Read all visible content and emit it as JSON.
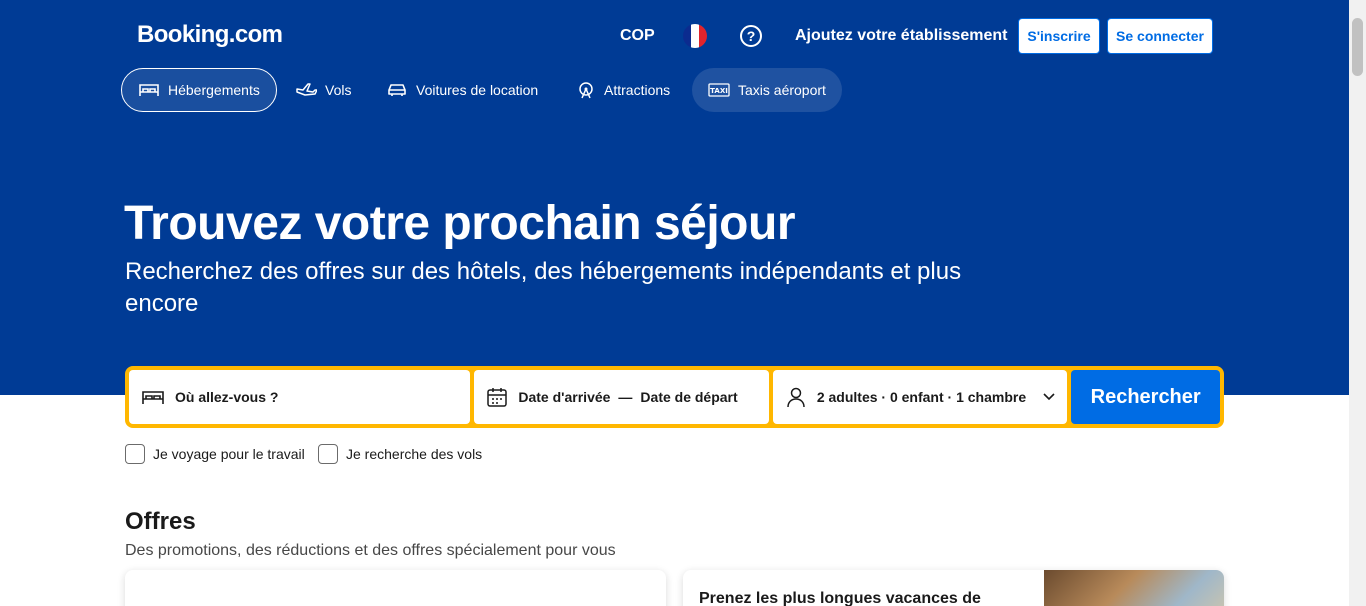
{
  "header": {
    "logo": "Booking.com",
    "currency": "COP",
    "language_flag": "france-flag",
    "help_icon": "question-icon",
    "add_property": "Ajoutez votre établissement",
    "signup": "S'inscrire",
    "signin": "Se connecter"
  },
  "nav": {
    "tabs": [
      {
        "label": "Hébergements",
        "icon": "bed-icon",
        "active": true
      },
      {
        "label": "Vols",
        "icon": "plane-icon",
        "active": false
      },
      {
        "label": "Voitures de location",
        "icon": "car-icon",
        "active": false
      },
      {
        "label": "Attractions",
        "icon": "attractions-icon",
        "active": false
      },
      {
        "label": "Taxis aéroport",
        "icon": "taxi-icon",
        "active": false
      }
    ]
  },
  "hero": {
    "title": "Trouvez votre prochain séjour",
    "subtitle": "Recherchez des offres sur des hôtels, des hébergements indépendants et plus encore"
  },
  "search": {
    "destination_placeholder": "Où allez-vous ?",
    "checkin": "Date d'arrivée",
    "separator": "—",
    "checkout": "Date de départ",
    "occupancy": "2 adultes · 0 enfant · 1 chambre",
    "button": "Rechercher"
  },
  "options": {
    "business": "Je voyage pour le travail",
    "flights": "Je recherche des vols"
  },
  "offers": {
    "title": "Offres",
    "subtitle": "Des promotions, des réductions et des offres spécialement pour vous",
    "card2_title": "Prenez les plus longues vacances de"
  },
  "colors": {
    "brand": "#003b95",
    "primary": "#006ce4",
    "search_border": "#ffb700"
  }
}
